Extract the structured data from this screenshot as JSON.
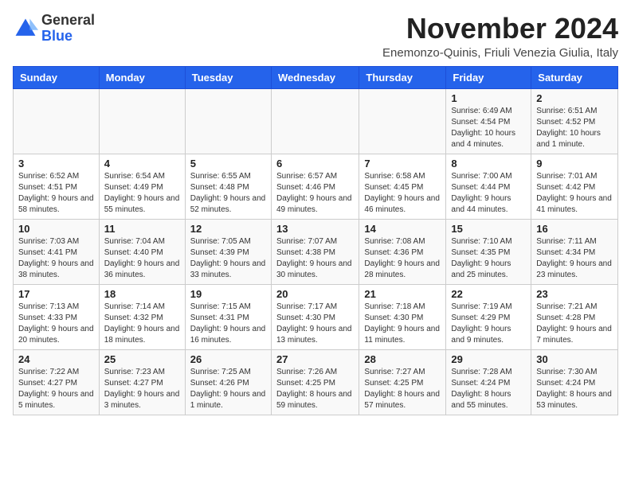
{
  "logo": {
    "general": "General",
    "blue": "Blue"
  },
  "title": "November 2024",
  "subtitle": "Enemonzo-Quinis, Friuli Venezia Giulia, Italy",
  "days_of_week": [
    "Sunday",
    "Monday",
    "Tuesday",
    "Wednesday",
    "Thursday",
    "Friday",
    "Saturday"
  ],
  "weeks": [
    [
      {
        "day": "",
        "info": ""
      },
      {
        "day": "",
        "info": ""
      },
      {
        "day": "",
        "info": ""
      },
      {
        "day": "",
        "info": ""
      },
      {
        "day": "",
        "info": ""
      },
      {
        "day": "1",
        "info": "Sunrise: 6:49 AM\nSunset: 4:54 PM\nDaylight: 10 hours and 4 minutes."
      },
      {
        "day": "2",
        "info": "Sunrise: 6:51 AM\nSunset: 4:52 PM\nDaylight: 10 hours and 1 minute."
      }
    ],
    [
      {
        "day": "3",
        "info": "Sunrise: 6:52 AM\nSunset: 4:51 PM\nDaylight: 9 hours and 58 minutes."
      },
      {
        "day": "4",
        "info": "Sunrise: 6:54 AM\nSunset: 4:49 PM\nDaylight: 9 hours and 55 minutes."
      },
      {
        "day": "5",
        "info": "Sunrise: 6:55 AM\nSunset: 4:48 PM\nDaylight: 9 hours and 52 minutes."
      },
      {
        "day": "6",
        "info": "Sunrise: 6:57 AM\nSunset: 4:46 PM\nDaylight: 9 hours and 49 minutes."
      },
      {
        "day": "7",
        "info": "Sunrise: 6:58 AM\nSunset: 4:45 PM\nDaylight: 9 hours and 46 minutes."
      },
      {
        "day": "8",
        "info": "Sunrise: 7:00 AM\nSunset: 4:44 PM\nDaylight: 9 hours and 44 minutes."
      },
      {
        "day": "9",
        "info": "Sunrise: 7:01 AM\nSunset: 4:42 PM\nDaylight: 9 hours and 41 minutes."
      }
    ],
    [
      {
        "day": "10",
        "info": "Sunrise: 7:03 AM\nSunset: 4:41 PM\nDaylight: 9 hours and 38 minutes."
      },
      {
        "day": "11",
        "info": "Sunrise: 7:04 AM\nSunset: 4:40 PM\nDaylight: 9 hours and 36 minutes."
      },
      {
        "day": "12",
        "info": "Sunrise: 7:05 AM\nSunset: 4:39 PM\nDaylight: 9 hours and 33 minutes."
      },
      {
        "day": "13",
        "info": "Sunrise: 7:07 AM\nSunset: 4:38 PM\nDaylight: 9 hours and 30 minutes."
      },
      {
        "day": "14",
        "info": "Sunrise: 7:08 AM\nSunset: 4:36 PM\nDaylight: 9 hours and 28 minutes."
      },
      {
        "day": "15",
        "info": "Sunrise: 7:10 AM\nSunset: 4:35 PM\nDaylight: 9 hours and 25 minutes."
      },
      {
        "day": "16",
        "info": "Sunrise: 7:11 AM\nSunset: 4:34 PM\nDaylight: 9 hours and 23 minutes."
      }
    ],
    [
      {
        "day": "17",
        "info": "Sunrise: 7:13 AM\nSunset: 4:33 PM\nDaylight: 9 hours and 20 minutes."
      },
      {
        "day": "18",
        "info": "Sunrise: 7:14 AM\nSunset: 4:32 PM\nDaylight: 9 hours and 18 minutes."
      },
      {
        "day": "19",
        "info": "Sunrise: 7:15 AM\nSunset: 4:31 PM\nDaylight: 9 hours and 16 minutes."
      },
      {
        "day": "20",
        "info": "Sunrise: 7:17 AM\nSunset: 4:30 PM\nDaylight: 9 hours and 13 minutes."
      },
      {
        "day": "21",
        "info": "Sunrise: 7:18 AM\nSunset: 4:30 PM\nDaylight: 9 hours and 11 minutes."
      },
      {
        "day": "22",
        "info": "Sunrise: 7:19 AM\nSunset: 4:29 PM\nDaylight: 9 hours and 9 minutes."
      },
      {
        "day": "23",
        "info": "Sunrise: 7:21 AM\nSunset: 4:28 PM\nDaylight: 9 hours and 7 minutes."
      }
    ],
    [
      {
        "day": "24",
        "info": "Sunrise: 7:22 AM\nSunset: 4:27 PM\nDaylight: 9 hours and 5 minutes."
      },
      {
        "day": "25",
        "info": "Sunrise: 7:23 AM\nSunset: 4:27 PM\nDaylight: 9 hours and 3 minutes."
      },
      {
        "day": "26",
        "info": "Sunrise: 7:25 AM\nSunset: 4:26 PM\nDaylight: 9 hours and 1 minute."
      },
      {
        "day": "27",
        "info": "Sunrise: 7:26 AM\nSunset: 4:25 PM\nDaylight: 8 hours and 59 minutes."
      },
      {
        "day": "28",
        "info": "Sunrise: 7:27 AM\nSunset: 4:25 PM\nDaylight: 8 hours and 57 minutes."
      },
      {
        "day": "29",
        "info": "Sunrise: 7:28 AM\nSunset: 4:24 PM\nDaylight: 8 hours and 55 minutes."
      },
      {
        "day": "30",
        "info": "Sunrise: 7:30 AM\nSunset: 4:24 PM\nDaylight: 8 hours and 53 minutes."
      }
    ]
  ]
}
